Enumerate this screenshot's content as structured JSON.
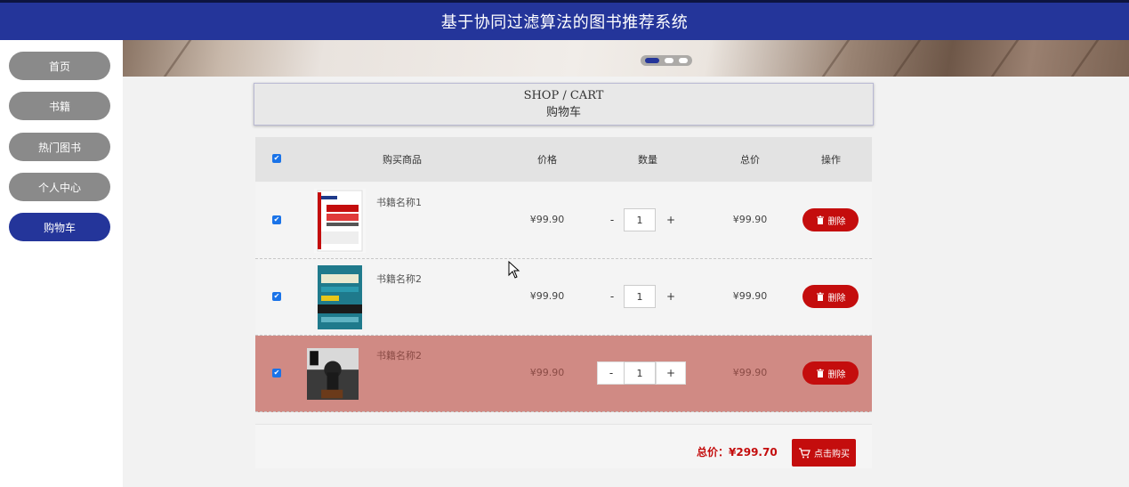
{
  "header": {
    "title": "基于协同过滤算法的图书推荐系统"
  },
  "sidebar": {
    "items": [
      {
        "label": "首页",
        "active": false
      },
      {
        "label": "书籍",
        "active": false
      },
      {
        "label": "热门图书",
        "active": false
      },
      {
        "label": "个人中心",
        "active": false
      },
      {
        "label": "购物车",
        "active": true
      }
    ]
  },
  "banner": {
    "slides": 3,
    "active_slide": 1
  },
  "cart": {
    "title_en": "SHOP / CART",
    "title_cn": "购物车",
    "columns": [
      "购买商品",
      "价格",
      "数量",
      "总价",
      "操作"
    ],
    "select_all_checked": true,
    "rows": [
      {
        "checked": true,
        "name": "书籍名称1",
        "price": "¥99.90",
        "qty": "1",
        "total": "¥99.90",
        "minus": "-",
        "plus": "+",
        "delete_label": "删除",
        "highlighted": false
      },
      {
        "checked": true,
        "name": "书籍名称2",
        "price": "¥99.90",
        "qty": "1",
        "total": "¥99.90",
        "minus": "-",
        "plus": "+",
        "delete_label": "删除",
        "highlighted": false
      },
      {
        "checked": true,
        "name": "书籍名称2",
        "price": "¥99.90",
        "qty": "1",
        "total": "¥99.90",
        "minus": "-",
        "plus": "+",
        "delete_label": "删除",
        "highlighted": true
      }
    ],
    "footer": {
      "total_label": "总价：",
      "total_value": "¥299.70",
      "buy_label": "点击购买"
    }
  },
  "colors": {
    "primary": "#24359a",
    "danger": "#c40d0d",
    "nav_inactive": "#8a8a8a",
    "row_highlight": "#d08a84"
  },
  "icons": [
    "trash-icon",
    "cart-icon",
    "check-icon",
    "mouse-pointer-icon"
  ]
}
